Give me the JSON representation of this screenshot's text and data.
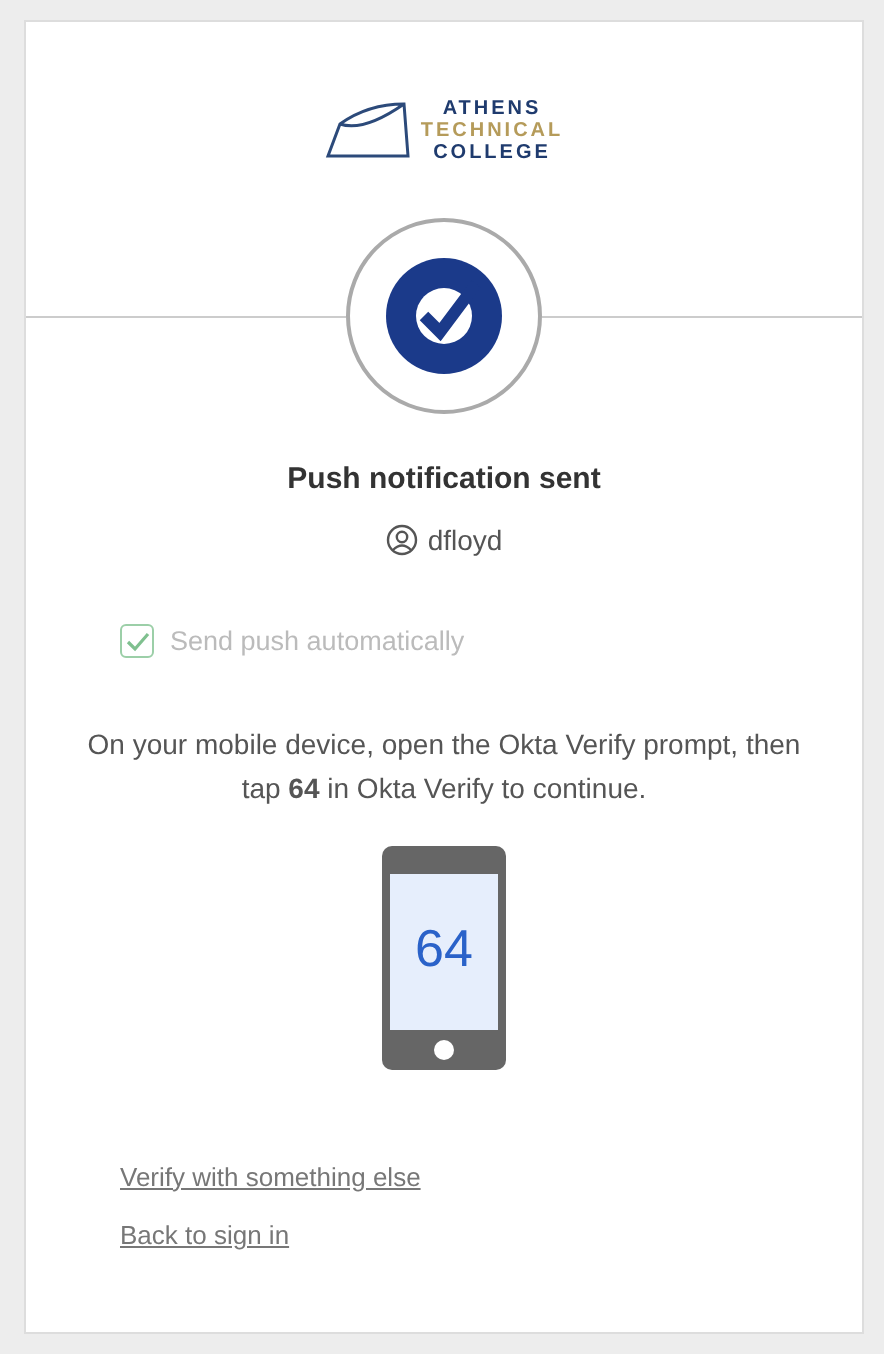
{
  "logo": {
    "lines": [
      "ATHENS",
      "TECHNICAL",
      "COLLEGE"
    ]
  },
  "title": "Push notification sent",
  "username": "dfloyd",
  "auto_push": {
    "label": "Send push automatically",
    "checked": true,
    "disabled": true
  },
  "instructions": "On your mobile device, open the Okta Verify prompt, then tap **64** in Okta Verify to continue.",
  "phone_number": "64",
  "links": [
    "Verify with something else",
    "Back to sign in"
  ]
}
